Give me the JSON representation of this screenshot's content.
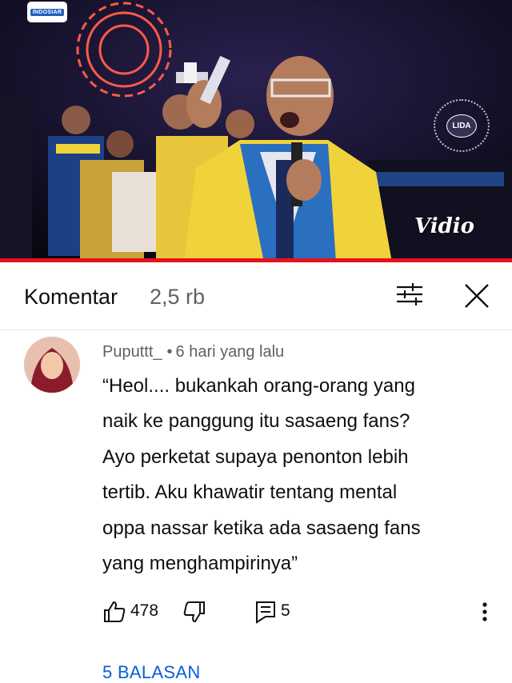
{
  "video": {
    "channel_logo_text": "INDOSIAR",
    "badge_text": "LIDA",
    "watermark_text": "Vidio",
    "progress": 1.0,
    "colors": {
      "progress": "#e4131b",
      "jacket_yellow": "#f0d33a",
      "jacket_blue": "#2a6fc0"
    }
  },
  "comments_header": {
    "title": "Komentar",
    "count": "2,5 rb",
    "filter_icon": "filter-icon",
    "close_icon": "close-icon"
  },
  "comment": {
    "author": "Puputtt_",
    "separator": "•",
    "time": "6 hari yang lalu",
    "text_lines": [
      "“Heol.... bukankah orang-orang yang",
      "naik ke panggung itu sasaeng fans?",
      "Ayo perketat supaya penonton lebih",
      "tertib. Aku khawatir tentang mental",
      "oppa nassar ketika ada sasaeng fans",
      "yang menghampirinya”"
    ],
    "like_count": "478",
    "reply_count": "5",
    "replies_label": "5 BALASAN",
    "colors": {
      "link": "#065fd4",
      "meta": "#606060"
    }
  }
}
